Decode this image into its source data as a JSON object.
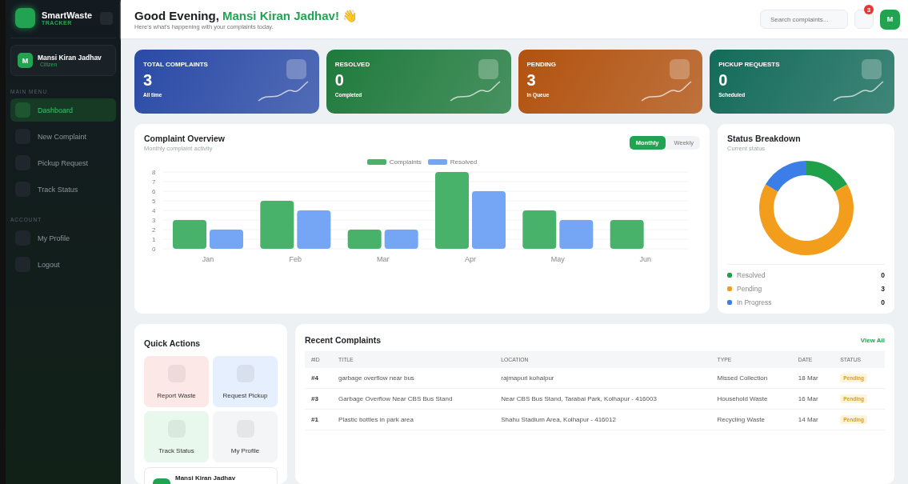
{
  "brand": {
    "name": "SmartWaste",
    "tagline": "TRACKER"
  },
  "user": {
    "initial": "M",
    "name": "Mansi Kiran Jadhav",
    "role": "Citizen"
  },
  "sidebar": {
    "sections": [
      {
        "title": "MAIN MENU",
        "items": [
          {
            "label": "Dashboard",
            "selected": true
          },
          {
            "label": "New Complaint",
            "selected": false
          },
          {
            "label": "Pickup Request",
            "selected": false
          },
          {
            "label": "Track Status",
            "selected": false
          }
        ]
      },
      {
        "title": "ACCOUNT",
        "items": [
          {
            "label": "My Profile",
            "selected": false
          },
          {
            "label": "Logout",
            "selected": false
          }
        ]
      }
    ]
  },
  "header": {
    "greeting": "Good Evening,",
    "name": "Mansi Kiran Jadhav!",
    "emoji": "👋",
    "subtitle": "Here's what's happening with your complaints today.",
    "search": {
      "placeholder": "Search complaints..."
    },
    "notification_count": "3",
    "avatar": "M"
  },
  "stats": [
    {
      "label": "TOTAL COMPLAINTS",
      "value": "3",
      "note": "All time",
      "color": "#2a4aa6"
    },
    {
      "label": "RESOLVED",
      "value": "0",
      "note": "Completed",
      "color": "#1f7a3c"
    },
    {
      "label": "PENDING",
      "value": "3",
      "note": "In Queue",
      "color": "#b2520f"
    },
    {
      "label": "PICKUP REQUESTS",
      "value": "0",
      "note": "Scheduled",
      "color": "#146b5a"
    }
  ],
  "overview": {
    "title": "Complaint Overview",
    "subtitle": "Monthly complaint activity",
    "tabs": [
      {
        "label": "Monthly",
        "selected": true
      },
      {
        "label": "Weekly",
        "selected": false
      }
    ],
    "chart_data": {
      "type": "bar",
      "categories": [
        "Jan",
        "Feb",
        "Mar",
        "Apr",
        "May",
        "Jun"
      ],
      "series": [
        {
          "name": "Complaints",
          "color": "#48b26a",
          "values": [
            3,
            5,
            2,
            8,
            4,
            3
          ]
        },
        {
          "name": "Resolved",
          "color": "#75a5f5",
          "values": [
            2,
            4,
            2,
            6,
            3,
            0
          ]
        }
      ],
      "ylim": [
        0,
        8
      ],
      "grid": true,
      "yticks": [
        0,
        1,
        2,
        3,
        4,
        5,
        6,
        7,
        8
      ]
    }
  },
  "breakdown": {
    "title": "Status Breakdown",
    "subtitle": "Current status",
    "legend": [
      {
        "label": "Resolved",
        "value": "0",
        "color": "#21a04a"
      },
      {
        "label": "Pending",
        "value": "3",
        "color": "#f29d1b"
      },
      {
        "label": "In Progress",
        "value": "0",
        "color": "#3b7ee8"
      }
    ]
  },
  "quick_actions": {
    "title": "Quick Actions",
    "items": [
      {
        "label": "Report Waste",
        "color": "#fde8e8"
      },
      {
        "label": "Request Pickup",
        "color": "#e6effd"
      },
      {
        "label": "Track Status",
        "color": "#e8f8ec"
      },
      {
        "label": "My Profile",
        "color": "#f4f5f6"
      }
    ],
    "profile_name": "Mansi Kiran Jadhav"
  },
  "recent": {
    "title": "Recent Complaints",
    "link": "View All",
    "columns": [
      "#ID",
      "TITLE",
      "LOCATION",
      "TYPE",
      "DATE",
      "STATUS"
    ],
    "rows": [
      {
        "id": "#4",
        "title": "garbage overflow near bus",
        "location": "rajmapuri kohalpur",
        "type": "Missed Collection",
        "date": "18 Mar",
        "status": "Pending"
      },
      {
        "id": "#3",
        "title": "Garbage Overflow Near CBS Bus Stand",
        "location": "Near CBS Bus Stand, Tarabai Park, Kolhapur - 416003",
        "type": "Household Waste",
        "date": "16 Mar",
        "status": "Pending"
      },
      {
        "id": "#1",
        "title": "Plastic bottles in park area",
        "location": "Shahu Stadium Area, Kolhapur - 416012",
        "type": "Recycling Waste",
        "date": "14 Mar",
        "status": "Pending"
      }
    ]
  }
}
